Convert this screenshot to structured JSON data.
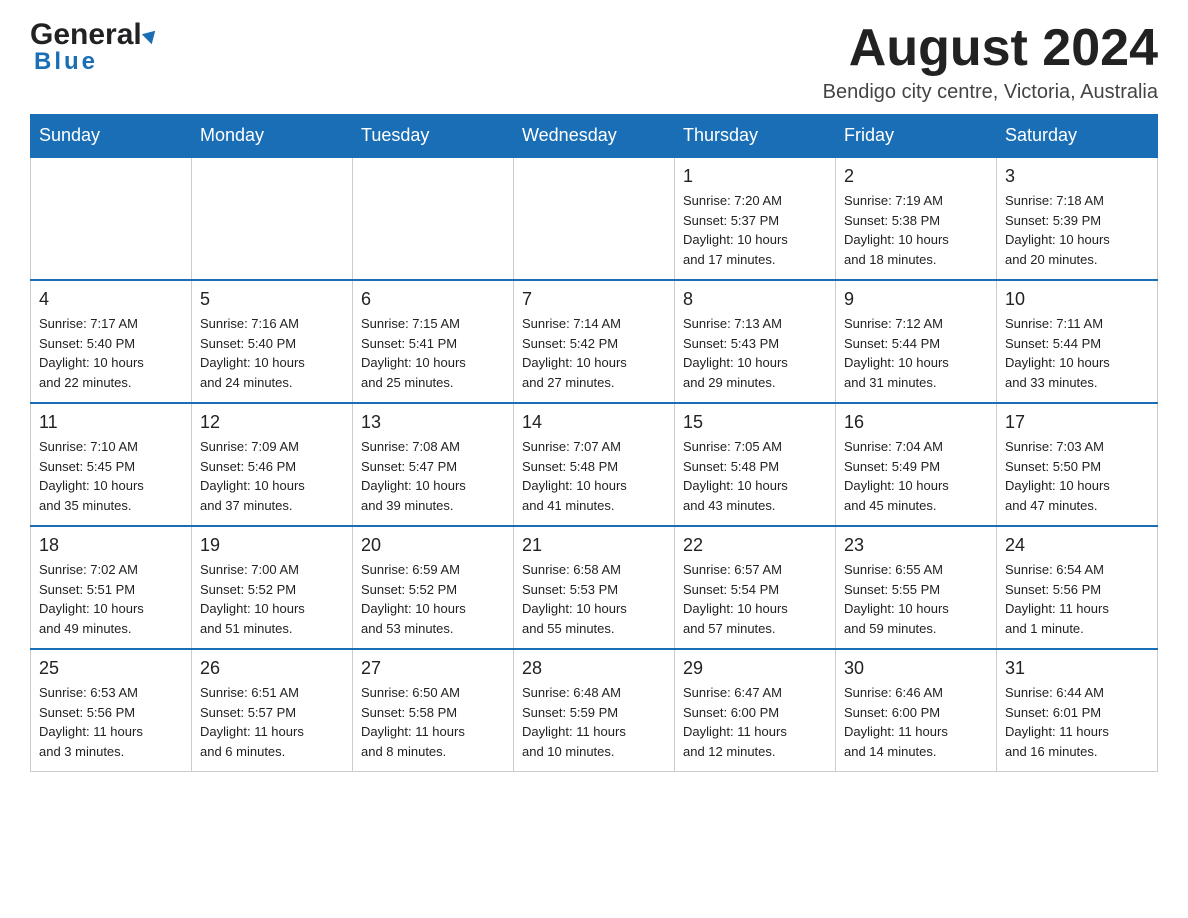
{
  "header": {
    "month_title": "August 2024",
    "location": "Bendigo city centre, Victoria, Australia",
    "logo_general": "General",
    "logo_blue": "Blue"
  },
  "days_of_week": [
    "Sunday",
    "Monday",
    "Tuesday",
    "Wednesday",
    "Thursday",
    "Friday",
    "Saturday"
  ],
  "weeks": [
    [
      {
        "day": "",
        "info": ""
      },
      {
        "day": "",
        "info": ""
      },
      {
        "day": "",
        "info": ""
      },
      {
        "day": "",
        "info": ""
      },
      {
        "day": "1",
        "info": "Sunrise: 7:20 AM\nSunset: 5:37 PM\nDaylight: 10 hours\nand 17 minutes."
      },
      {
        "day": "2",
        "info": "Sunrise: 7:19 AM\nSunset: 5:38 PM\nDaylight: 10 hours\nand 18 minutes."
      },
      {
        "day": "3",
        "info": "Sunrise: 7:18 AM\nSunset: 5:39 PM\nDaylight: 10 hours\nand 20 minutes."
      }
    ],
    [
      {
        "day": "4",
        "info": "Sunrise: 7:17 AM\nSunset: 5:40 PM\nDaylight: 10 hours\nand 22 minutes."
      },
      {
        "day": "5",
        "info": "Sunrise: 7:16 AM\nSunset: 5:40 PM\nDaylight: 10 hours\nand 24 minutes."
      },
      {
        "day": "6",
        "info": "Sunrise: 7:15 AM\nSunset: 5:41 PM\nDaylight: 10 hours\nand 25 minutes."
      },
      {
        "day": "7",
        "info": "Sunrise: 7:14 AM\nSunset: 5:42 PM\nDaylight: 10 hours\nand 27 minutes."
      },
      {
        "day": "8",
        "info": "Sunrise: 7:13 AM\nSunset: 5:43 PM\nDaylight: 10 hours\nand 29 minutes."
      },
      {
        "day": "9",
        "info": "Sunrise: 7:12 AM\nSunset: 5:44 PM\nDaylight: 10 hours\nand 31 minutes."
      },
      {
        "day": "10",
        "info": "Sunrise: 7:11 AM\nSunset: 5:44 PM\nDaylight: 10 hours\nand 33 minutes."
      }
    ],
    [
      {
        "day": "11",
        "info": "Sunrise: 7:10 AM\nSunset: 5:45 PM\nDaylight: 10 hours\nand 35 minutes."
      },
      {
        "day": "12",
        "info": "Sunrise: 7:09 AM\nSunset: 5:46 PM\nDaylight: 10 hours\nand 37 minutes."
      },
      {
        "day": "13",
        "info": "Sunrise: 7:08 AM\nSunset: 5:47 PM\nDaylight: 10 hours\nand 39 minutes."
      },
      {
        "day": "14",
        "info": "Sunrise: 7:07 AM\nSunset: 5:48 PM\nDaylight: 10 hours\nand 41 minutes."
      },
      {
        "day": "15",
        "info": "Sunrise: 7:05 AM\nSunset: 5:48 PM\nDaylight: 10 hours\nand 43 minutes."
      },
      {
        "day": "16",
        "info": "Sunrise: 7:04 AM\nSunset: 5:49 PM\nDaylight: 10 hours\nand 45 minutes."
      },
      {
        "day": "17",
        "info": "Sunrise: 7:03 AM\nSunset: 5:50 PM\nDaylight: 10 hours\nand 47 minutes."
      }
    ],
    [
      {
        "day": "18",
        "info": "Sunrise: 7:02 AM\nSunset: 5:51 PM\nDaylight: 10 hours\nand 49 minutes."
      },
      {
        "day": "19",
        "info": "Sunrise: 7:00 AM\nSunset: 5:52 PM\nDaylight: 10 hours\nand 51 minutes."
      },
      {
        "day": "20",
        "info": "Sunrise: 6:59 AM\nSunset: 5:52 PM\nDaylight: 10 hours\nand 53 minutes."
      },
      {
        "day": "21",
        "info": "Sunrise: 6:58 AM\nSunset: 5:53 PM\nDaylight: 10 hours\nand 55 minutes."
      },
      {
        "day": "22",
        "info": "Sunrise: 6:57 AM\nSunset: 5:54 PM\nDaylight: 10 hours\nand 57 minutes."
      },
      {
        "day": "23",
        "info": "Sunrise: 6:55 AM\nSunset: 5:55 PM\nDaylight: 10 hours\nand 59 minutes."
      },
      {
        "day": "24",
        "info": "Sunrise: 6:54 AM\nSunset: 5:56 PM\nDaylight: 11 hours\nand 1 minute."
      }
    ],
    [
      {
        "day": "25",
        "info": "Sunrise: 6:53 AM\nSunset: 5:56 PM\nDaylight: 11 hours\nand 3 minutes."
      },
      {
        "day": "26",
        "info": "Sunrise: 6:51 AM\nSunset: 5:57 PM\nDaylight: 11 hours\nand 6 minutes."
      },
      {
        "day": "27",
        "info": "Sunrise: 6:50 AM\nSunset: 5:58 PM\nDaylight: 11 hours\nand 8 minutes."
      },
      {
        "day": "28",
        "info": "Sunrise: 6:48 AM\nSunset: 5:59 PM\nDaylight: 11 hours\nand 10 minutes."
      },
      {
        "day": "29",
        "info": "Sunrise: 6:47 AM\nSunset: 6:00 PM\nDaylight: 11 hours\nand 12 minutes."
      },
      {
        "day": "30",
        "info": "Sunrise: 6:46 AM\nSunset: 6:00 PM\nDaylight: 11 hours\nand 14 minutes."
      },
      {
        "day": "31",
        "info": "Sunrise: 6:44 AM\nSunset: 6:01 PM\nDaylight: 11 hours\nand 16 minutes."
      }
    ]
  ]
}
